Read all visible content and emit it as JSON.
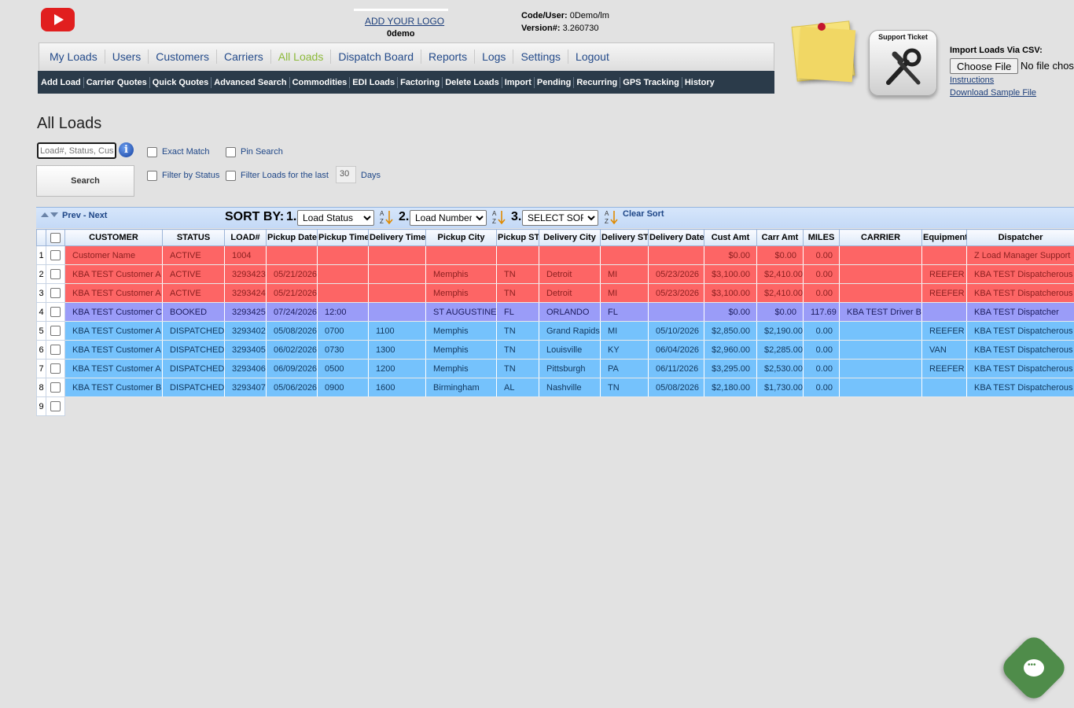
{
  "header": {
    "add_logo": "ADD YOUR LOGO",
    "company": "0demo",
    "code_user_label": "Code/User:",
    "code_user_value": "0Demo/lm",
    "version_label": "Version#:",
    "version_value": "3.260730"
  },
  "nav": {
    "items": [
      {
        "label": "My Loads"
      },
      {
        "label": "Users"
      },
      {
        "label": "Customers"
      },
      {
        "label": "Carriers"
      },
      {
        "label": "All Loads"
      },
      {
        "label": "Dispatch Board"
      },
      {
        "label": "Reports"
      },
      {
        "label": "Logs"
      },
      {
        "label": "Settings"
      },
      {
        "label": "Logout"
      }
    ],
    "active": "All Loads"
  },
  "subnav": {
    "items": [
      {
        "label": "Add Load"
      },
      {
        "label": "Carrier Quotes"
      },
      {
        "label": "Quick Quotes"
      },
      {
        "label": "Advanced Search"
      },
      {
        "label": "Commodities"
      },
      {
        "label": "EDI Loads"
      },
      {
        "label": "Factoring"
      },
      {
        "label": "Delete Loads"
      },
      {
        "label": "Import"
      },
      {
        "label": "Pending"
      },
      {
        "label": "Recurring"
      },
      {
        "label": "GPS Tracking"
      },
      {
        "label": "History"
      }
    ]
  },
  "support": {
    "label": "Support Ticket"
  },
  "import": {
    "title": "Import Loads Via CSV:",
    "choose_file": "Choose File",
    "no_file": "No file chosen",
    "instructions": "Instructions",
    "sample": "Download Sample File"
  },
  "page": {
    "title": "All Loads"
  },
  "search": {
    "placeholder": "Load#, Status, Customer",
    "button": "Search",
    "exact_match": "Exact Match",
    "pin_search": "Pin Search",
    "filter_status": "Filter by Status",
    "filter_last": "Filter Loads for the last",
    "days_value": "30",
    "days_label": "Days"
  },
  "toolbar": {
    "prev_next": "Prev - Next",
    "sort_by": "SORT BY:",
    "n1": "1.",
    "n2": "2.",
    "n3": "3.",
    "sort1": "Load Status",
    "sort2": "Load Number",
    "sort3": "SELECT SORT",
    "clear_sort": "Clear Sort"
  },
  "columns": [
    "CUSTOMER",
    "STATUS",
    "LOAD#",
    "Pickup Date",
    "Pickup Time",
    "Delivery Time",
    "Pickup City",
    "Pickup ST",
    "Delivery City",
    "Delivery ST",
    "Delivery Date",
    "Cust Amt",
    "Carr Amt",
    "MILES",
    "CARRIER",
    "Equipment",
    "Dispatcher"
  ],
  "rows": [
    {
      "n": "1",
      "cls": "r-active",
      "c": [
        "Customer Name",
        "ACTIVE",
        "1004",
        "",
        "",
        "",
        "",
        "",
        "",
        "",
        "",
        "$0.00",
        "$0.00",
        "0.00",
        "",
        "",
        "Z Load Manager Support"
      ]
    },
    {
      "n": "2",
      "cls": "r-active",
      "c": [
        "KBA TEST Customer A",
        "ACTIVE",
        "3293423",
        "05/21/2026",
        "",
        "",
        "Memphis",
        "TN",
        "Detroit",
        "MI",
        "05/23/2026",
        "$3,100.00",
        "$2,410.00",
        "0.00",
        "",
        "REEFER",
        "KBA TEST Dispatcherous"
      ]
    },
    {
      "n": "3",
      "cls": "r-active",
      "c": [
        "KBA TEST Customer A",
        "ACTIVE",
        "3293424",
        "05/21/2026",
        "",
        "",
        "Memphis",
        "TN",
        "Detroit",
        "MI",
        "05/23/2026",
        "$3,100.00",
        "$2,410.00",
        "0.00",
        "",
        "REEFER",
        "KBA TEST Dispatcherous"
      ]
    },
    {
      "n": "4",
      "cls": "r-booked",
      "c": [
        "KBA TEST Customer C",
        "BOOKED",
        "3293425",
        "07/24/2026",
        "12:00",
        "",
        "ST AUGUSTINE",
        "FL",
        "ORLANDO",
        "FL",
        "",
        "$0.00",
        "$0.00",
        "117.69",
        "KBA TEST Driver B",
        "",
        "KBA TEST Dispatcher"
      ]
    },
    {
      "n": "5",
      "cls": "r-dispatched",
      "c": [
        "KBA TEST Customer A",
        "DISPATCHED",
        "3293402",
        "05/08/2026",
        "0700",
        "1100",
        "Memphis",
        "TN",
        "Grand Rapids",
        "MI",
        "05/10/2026",
        "$2,850.00",
        "$2,190.00",
        "0.00",
        "",
        "REEFER",
        "KBA TEST Dispatcherous"
      ]
    },
    {
      "n": "6",
      "cls": "r-dispatched",
      "c": [
        "KBA TEST Customer A",
        "DISPATCHED",
        "3293405",
        "06/02/2026",
        "0730",
        "1300",
        "Memphis",
        "TN",
        "Louisville",
        "KY",
        "06/04/2026",
        "$2,960.00",
        "$2,285.00",
        "0.00",
        "",
        "VAN",
        "KBA TEST Dispatcherous"
      ]
    },
    {
      "n": "7",
      "cls": "r-dispatched",
      "c": [
        "KBA TEST Customer A",
        "DISPATCHED",
        "3293406",
        "06/09/2026",
        "0500",
        "1200",
        "Memphis",
        "TN",
        "Pittsburgh",
        "PA",
        "06/11/2026",
        "$3,295.00",
        "$2,530.00",
        "0.00",
        "",
        "REEFER",
        "KBA TEST Dispatcherous"
      ]
    },
    {
      "n": "8",
      "cls": "r-dispatched",
      "c": [
        "KBA TEST Customer B",
        "DISPATCHED",
        "3293407",
        "05/06/2026",
        "0900",
        "1600",
        "Birmingham",
        "AL",
        "Nashville",
        "TN",
        "05/08/2026",
        "$2,180.00",
        "$1,730.00",
        "0.00",
        "",
        "",
        "KBA TEST Dispatcherous"
      ]
    },
    {
      "n": "9",
      "cls": "r-empty",
      "c": []
    }
  ],
  "colors": {
    "active": "#fd6565",
    "booked": "#9a9cf8",
    "dispatched": "#75c2fc",
    "nav_active": "#8dba3a"
  }
}
